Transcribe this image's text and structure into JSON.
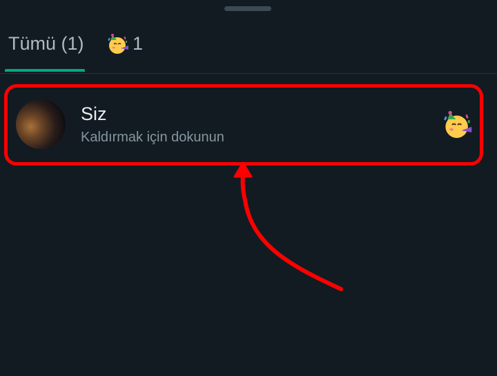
{
  "tabs": {
    "all_label": "Tümü (1)",
    "emoji_tab_count": "1",
    "emoji_tab_icon": "partying-face-emoji"
  },
  "reaction": {
    "name": "Siz",
    "subtitle": "Kaldırmak için dokunun",
    "emoji_icon": "partying-face-emoji"
  },
  "colors": {
    "background": "#121b22",
    "accent": "#00a884",
    "annotation": "#ff0000"
  }
}
